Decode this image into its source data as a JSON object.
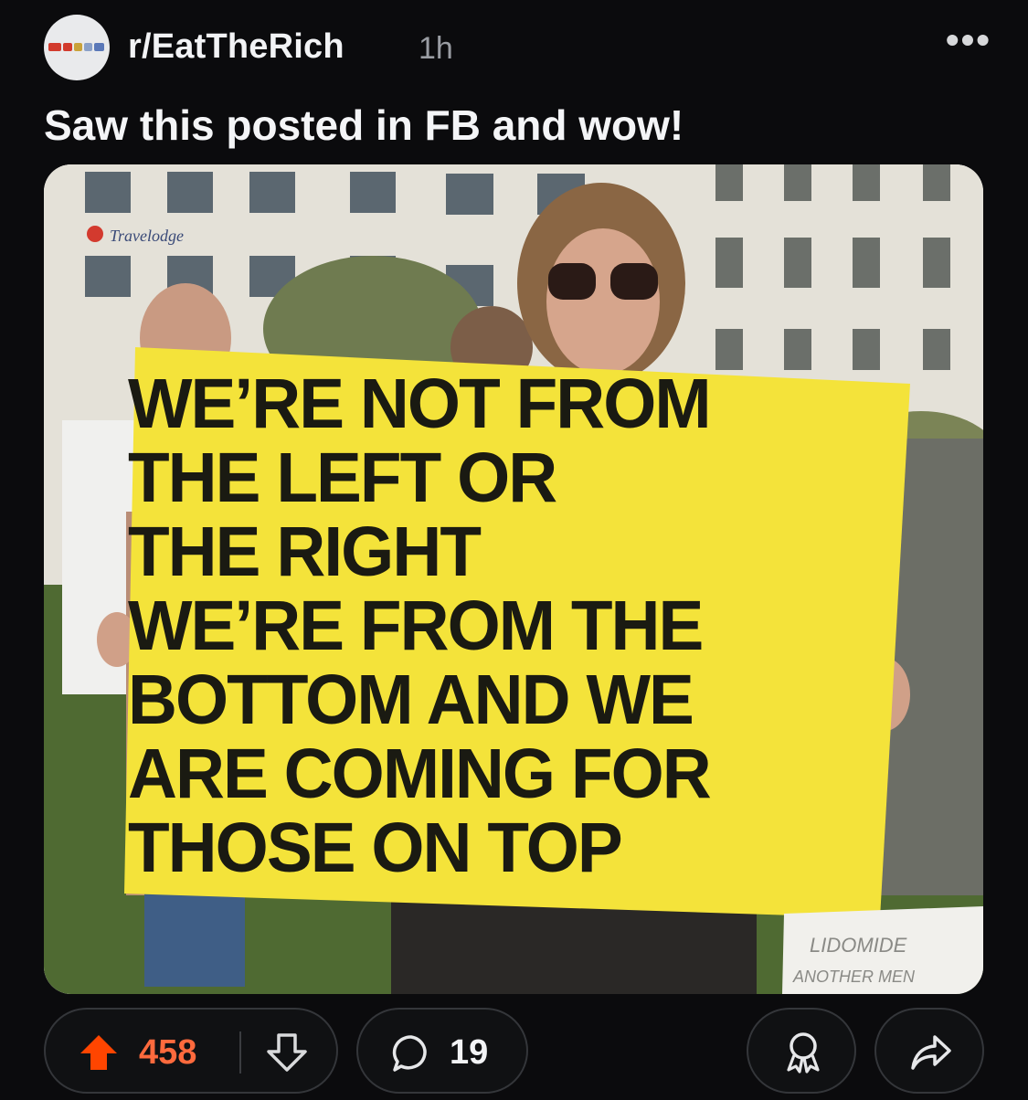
{
  "post": {
    "subreddit": "r/EatTheRich",
    "age": "1h",
    "more_label": "•••",
    "title": "Saw this posted in FB and wow!"
  },
  "image": {
    "sign_lines": [
      "WE’RE NOT FROM",
      "THE LEFT OR",
      "THE RIGHT",
      "WE’RE FROM THE",
      "BOTTOM AND WE",
      "ARE COMING FOR",
      "THOSE ON TOP"
    ],
    "hotel_sign": "Travelodge",
    "bottom_sign_line1": "LIDOMIDE",
    "bottom_sign_line2": "ANOTHER MEN",
    "sign_color": "#f4e33a"
  },
  "actions": {
    "score": "458",
    "comments": "19",
    "upvote_color": "#ff4500",
    "icons": [
      "upvote-icon",
      "downvote-icon",
      "comment-icon",
      "award-icon",
      "share-icon"
    ]
  }
}
